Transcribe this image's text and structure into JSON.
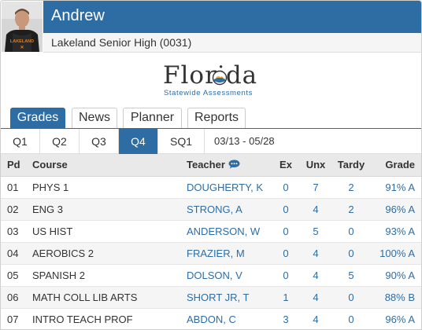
{
  "student": {
    "name": "Andrew",
    "school": "Lakeland Senior High (0031)",
    "avatar_jersey_text": "LAKELAND"
  },
  "logo": {
    "title": "Florida",
    "subtitle": "Statewide Assessments"
  },
  "tabs": [
    {
      "label": "Grades",
      "active": true
    },
    {
      "label": "News",
      "active": false
    },
    {
      "label": "Planner",
      "active": false
    },
    {
      "label": "Reports",
      "active": false
    }
  ],
  "quarters": [
    {
      "label": "Q1",
      "active": false
    },
    {
      "label": "Q2",
      "active": false
    },
    {
      "label": "Q3",
      "active": false
    },
    {
      "label": "Q4",
      "active": true
    },
    {
      "label": "SQ1",
      "active": false
    }
  ],
  "date_range": "03/13 - 05/28",
  "table": {
    "headers": {
      "pd": "Pd",
      "course": "Course",
      "teacher": "Teacher",
      "ex": "Ex",
      "unx": "Unx",
      "tardy": "Tardy",
      "grade": "Grade"
    },
    "rows": [
      {
        "pd": "01",
        "course": "PHYS 1",
        "teacher": "DOUGHERTY, K",
        "ex": "0",
        "unx": "7",
        "tardy": "2",
        "grade": "91% A"
      },
      {
        "pd": "02",
        "course": "ENG 3",
        "teacher": "STRONG, A",
        "ex": "0",
        "unx": "4",
        "tardy": "2",
        "grade": "96% A"
      },
      {
        "pd": "03",
        "course": "US HIST",
        "teacher": "ANDERSON, W",
        "ex": "0",
        "unx": "5",
        "tardy": "0",
        "grade": "93% A"
      },
      {
        "pd": "04",
        "course": "AEROBICS 2",
        "teacher": "FRAZIER, M",
        "ex": "0",
        "unx": "4",
        "tardy": "0",
        "grade": "100% A"
      },
      {
        "pd": "05",
        "course": "SPANISH 2",
        "teacher": "DOLSON, V",
        "ex": "0",
        "unx": "4",
        "tardy": "5",
        "grade": "90% A"
      },
      {
        "pd": "06",
        "course": "MATH COLL LIB ARTS",
        "teacher": "SHORT JR, T",
        "ex": "1",
        "unx": "4",
        "tardy": "0",
        "grade": "88% B"
      },
      {
        "pd": "07",
        "course": "INTRO TEACH PROF",
        "teacher": "ABDON, C",
        "ex": "3",
        "unx": "4",
        "tardy": "0",
        "grade": "96% A"
      }
    ]
  },
  "colors": {
    "accent": "#2e6da4",
    "header_bg": "#e9e9e9",
    "row_alt": "#f5f5f5"
  },
  "icons": {
    "teacher_message": "chat-bubble-icon"
  }
}
